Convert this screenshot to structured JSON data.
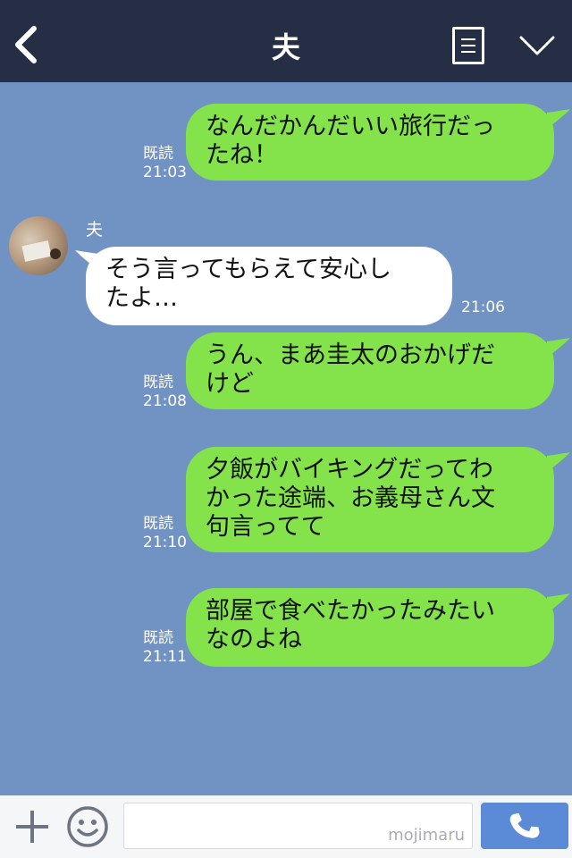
{
  "header": {
    "title": "夫"
  },
  "messages": [
    {
      "side": "right",
      "text_lines": [
        "なんだかんだいい旅行だっ",
        "たね！"
      ],
      "read": "既読",
      "time": "21:03"
    },
    {
      "side": "left",
      "sender": "夫",
      "text_lines": [
        "そう言ってもらえて安心し",
        "たよ…"
      ],
      "time": "21:06"
    },
    {
      "side": "right",
      "text_lines": [
        "うん、まあ圭太のおかげだ",
        "けど"
      ],
      "read": "既読",
      "time": "21:08"
    },
    {
      "side": "right",
      "text_lines": [
        "夕飯がバイキングだってわ",
        "かった途端、お義母さん文",
        "句言ってて"
      ],
      "read": "既読",
      "time": "21:10"
    },
    {
      "side": "right",
      "text_lines": [
        "部屋で食べたかったみたい",
        "なのよね"
      ],
      "read": "既読",
      "time": "21:11"
    }
  ],
  "footer": {
    "input_value": "",
    "watermark": "mojimaru"
  },
  "colors": {
    "header": "#252e45",
    "chat_bg": "#7093c4",
    "my_bubble": "#84e24a",
    "their_bubble": "#ffffff",
    "call_button": "#5b8ad6"
  },
  "icons": [
    "back-icon",
    "menu-icon",
    "chevron-down-icon",
    "plus-icon",
    "emoji-icon",
    "phone-icon"
  ]
}
